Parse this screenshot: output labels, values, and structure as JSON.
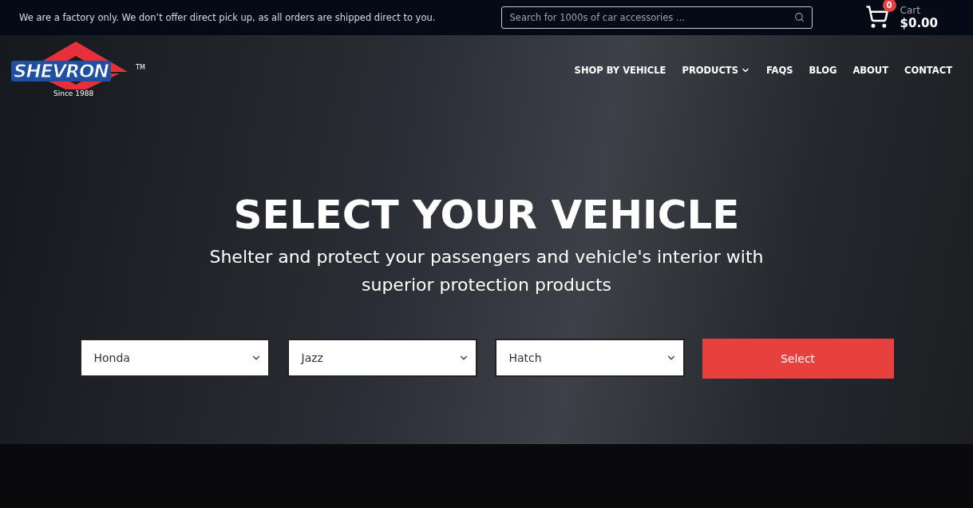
{
  "top_bar": {
    "notice": "We are a factory only. We don’t offer direct pick up, as all orders are shipped direct to you.",
    "search": {
      "placeholder": "Search for 1000s of car accessories ..."
    },
    "cart": {
      "count": "0",
      "label": "Cart",
      "total": "$0.00"
    }
  },
  "logo": {
    "name": "SHEVRON",
    "since": "Since 1988",
    "tm": "TM"
  },
  "nav": [
    {
      "label": "SHOP BY VEHICLE",
      "dropdown": false
    },
    {
      "label": "PRODUCTS",
      "dropdown": true
    },
    {
      "label": "FAQS",
      "dropdown": false
    },
    {
      "label": "BLOG",
      "dropdown": false
    },
    {
      "label": "ABOUT",
      "dropdown": false
    },
    {
      "label": "CONTACT",
      "dropdown": false
    }
  ],
  "hero": {
    "title": "SELECT YOUR VEHICLE",
    "subtitle": "Shelter and protect your passengers and vehicle's interior with superior protection products",
    "selects": [
      {
        "value": "Honda"
      },
      {
        "value": "Jazz"
      },
      {
        "value": "Hatch"
      }
    ],
    "button": "Select"
  }
}
